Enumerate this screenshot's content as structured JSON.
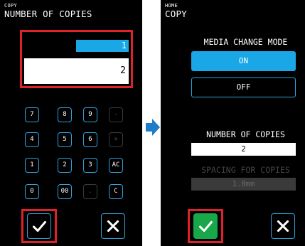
{
  "left_screen": {
    "breadcrumb": "COPY",
    "title": "NUMBER OF COPIES",
    "display": {
      "selected_value": "1",
      "input_value": "2"
    },
    "keypad": [
      [
        "7",
        "8",
        "9",
        "-"
      ],
      [
        "4",
        "5",
        "6",
        "+"
      ],
      [
        "1",
        "2",
        "3",
        "AC"
      ],
      [
        "0",
        "00",
        ".",
        "C"
      ]
    ],
    "disabled_keys": [
      "-",
      "+",
      "."
    ],
    "confirm_icon": "check-icon",
    "cancel_icon": "close-icon"
  },
  "arrow_icon": "arrow-right-icon",
  "right_screen": {
    "breadcrumb": "HOME",
    "title": "COPY",
    "media_change_label": "MEDIA CHANGE MODE",
    "on_label": "ON",
    "off_label": "OFF",
    "copies_label": "NUMBER OF COPIES",
    "copies_value": "2",
    "spacing_label": "SPACING FOR COPIES",
    "spacing_value": "1.0mm",
    "confirm_icon": "check-icon",
    "cancel_icon": "close-icon"
  },
  "colors": {
    "accent": "#1aa7e6",
    "highlight": "#e0202b",
    "confirm_green": "#18a84a",
    "background": "#000000"
  }
}
